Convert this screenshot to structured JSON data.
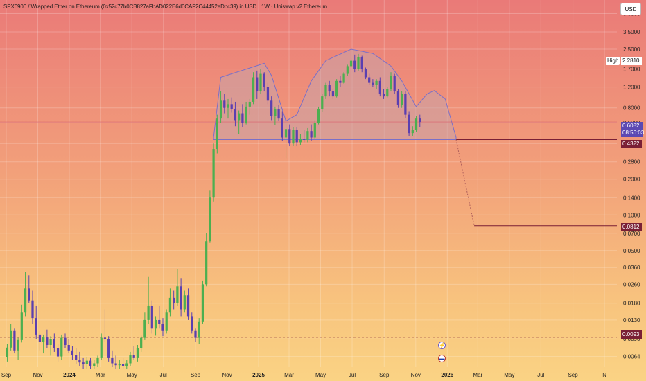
{
  "title": "SPX6900 / Wrapped Ether on Ethereum (0x52c77b0CB827aFbAD022E6d6CAF2C44452eDbc39) in USD · 1W · Uniswap v2 Ethereum",
  "currency_button": "USD",
  "price_labels": {
    "high_label": "High",
    "high_value": "2.2810",
    "current_value": "0.6082",
    "countdown": "08:56:03",
    "neckline_value": "0.4322",
    "target_value": "0.0812",
    "support_value": "0.0093"
  },
  "colors": {
    "bull": "#4caf50",
    "bear": "#5b3fb0",
    "pattern_fill": "#c8a3a9",
    "pattern_stroke": "#7a6fc8",
    "level_line": "#7a1f35",
    "current_tag": "#5b49b3"
  },
  "events": [
    {
      "icon": "lightning-icon",
      "glyph": "⚡"
    },
    {
      "icon": "us-flag-icon",
      "glyph": "▬"
    }
  ],
  "chart_data": {
    "type": "candlestick",
    "scale": "log",
    "y_ticks": [
      "5.0000",
      "3.5000",
      "2.5000",
      "1.7000",
      "1.2000",
      "0.8000",
      "0.6000",
      "0.4000",
      "0.2800",
      "0.2000",
      "0.1400",
      "0.1000",
      "0.0700",
      "0.0500",
      "0.0360",
      "0.0260",
      "0.0180",
      "0.0130",
      "0.0090",
      "0.0064"
    ],
    "ylim": [
      0.0052,
      6.5
    ],
    "x_ticks": [
      {
        "label": "Sep",
        "bold": false,
        "date": "2023-09-01"
      },
      {
        "label": "Nov",
        "bold": false,
        "date": "2023-11-01"
      },
      {
        "label": "2024",
        "bold": true,
        "date": "2024-01-01"
      },
      {
        "label": "Mar",
        "bold": false,
        "date": "2024-03-01"
      },
      {
        "label": "May",
        "bold": false,
        "date": "2024-05-01"
      },
      {
        "label": "Jul",
        "bold": false,
        "date": "2024-07-01"
      },
      {
        "label": "Sep",
        "bold": false,
        "date": "2024-09-01"
      },
      {
        "label": "Nov",
        "bold": false,
        "date": "2024-11-01"
      },
      {
        "label": "2025",
        "bold": true,
        "date": "2025-01-01"
      },
      {
        "label": "Mar",
        "bold": false,
        "date": "2025-03-01"
      },
      {
        "label": "May",
        "bold": false,
        "date": "2025-05-01"
      },
      {
        "label": "Jul",
        "bold": false,
        "date": "2025-07-01"
      },
      {
        "label": "Sep",
        "bold": false,
        "date": "2025-09-01"
      },
      {
        "label": "Nov",
        "bold": false,
        "date": "2025-11-01"
      },
      {
        "label": "2026",
        "bold": true,
        "date": "2026-01-01"
      },
      {
        "label": "Mar",
        "bold": false,
        "date": "2026-03-01"
      },
      {
        "label": "May",
        "bold": false,
        "date": "2026-05-01"
      },
      {
        "label": "Jul",
        "bold": false,
        "date": "2026-07-01"
      },
      {
        "label": "Sep",
        "bold": false,
        "date": "2026-09-01"
      },
      {
        "label": "N",
        "bold": false,
        "date": "2026-11-01"
      }
    ],
    "xlim": [
      "2023-08-20",
      "2026-11-25"
    ],
    "candles": [
      [
        "2023-09-03",
        0.0063,
        0.0082,
        0.0058,
        0.0076
      ],
      [
        "2023-09-10",
        0.0076,
        0.012,
        0.0072,
        0.0105
      ],
      [
        "2023-09-17",
        0.0105,
        0.011,
        0.0068,
        0.0072
      ],
      [
        "2023-09-24",
        0.0072,
        0.0092,
        0.006,
        0.0088
      ],
      [
        "2023-10-01",
        0.0088,
        0.0175,
        0.0084,
        0.015
      ],
      [
        "2023-10-08",
        0.015,
        0.033,
        0.014,
        0.024
      ],
      [
        "2023-10-15",
        0.024,
        0.031,
        0.018,
        0.019
      ],
      [
        "2023-10-22",
        0.019,
        0.023,
        0.012,
        0.0135
      ],
      [
        "2023-10-29",
        0.0135,
        0.017,
        0.009,
        0.0098
      ],
      [
        "2023-11-05",
        0.0098,
        0.0105,
        0.0072,
        0.0085
      ],
      [
        "2023-11-12",
        0.0085,
        0.0098,
        0.0068,
        0.0094
      ],
      [
        "2023-11-19",
        0.0094,
        0.0108,
        0.0075,
        0.008
      ],
      [
        "2023-11-26",
        0.008,
        0.0095,
        0.0065,
        0.009
      ],
      [
        "2023-12-03",
        0.009,
        0.01,
        0.007,
        0.0075
      ],
      [
        "2023-12-10",
        0.0075,
        0.0082,
        0.0058,
        0.0064
      ],
      [
        "2023-12-17",
        0.0064,
        0.0098,
        0.006,
        0.0092
      ],
      [
        "2023-12-24",
        0.0092,
        0.01,
        0.0075,
        0.008
      ],
      [
        "2023-12-31",
        0.008,
        0.009,
        0.0068,
        0.0072
      ],
      [
        "2024-01-07",
        0.0072,
        0.0078,
        0.006,
        0.0066
      ],
      [
        "2024-01-14",
        0.0066,
        0.0075,
        0.0055,
        0.006
      ],
      [
        "2024-01-21",
        0.006,
        0.007,
        0.0053,
        0.0057
      ],
      [
        "2024-01-28",
        0.0057,
        0.0062,
        0.005,
        0.0055
      ],
      [
        "2024-02-04",
        0.0055,
        0.0063,
        0.005,
        0.0059
      ],
      [
        "2024-02-11",
        0.0059,
        0.0062,
        0.005,
        0.0053
      ],
      [
        "2024-02-18",
        0.0053,
        0.006,
        0.005,
        0.0056
      ],
      [
        "2024-02-25",
        0.0056,
        0.0065,
        0.0052,
        0.0062
      ],
      [
        "2024-03-03",
        0.0062,
        0.01,
        0.006,
        0.0092
      ],
      [
        "2024-03-10",
        0.0092,
        0.016,
        0.0085,
        0.009
      ],
      [
        "2024-03-17",
        0.009,
        0.0095,
        0.0058,
        0.0062
      ],
      [
        "2024-03-24",
        0.0062,
        0.0072,
        0.0052,
        0.0056
      ],
      [
        "2024-03-31",
        0.0056,
        0.0065,
        0.005,
        0.0054
      ],
      [
        "2024-04-07",
        0.0054,
        0.006,
        0.005,
        0.0055
      ],
      [
        "2024-04-14",
        0.0055,
        0.0062,
        0.005,
        0.0053
      ],
      [
        "2024-04-21",
        0.0053,
        0.006,
        0.005,
        0.0056
      ],
      [
        "2024-04-28",
        0.0056,
        0.007,
        0.0053,
        0.0066
      ],
      [
        "2024-05-05",
        0.0066,
        0.0078,
        0.006,
        0.0062
      ],
      [
        "2024-05-12",
        0.0062,
        0.008,
        0.0058,
        0.0075
      ],
      [
        "2024-05-19",
        0.0075,
        0.0096,
        0.007,
        0.0092
      ],
      [
        "2024-05-26",
        0.0092,
        0.015,
        0.0088,
        0.013
      ],
      [
        "2024-06-02",
        0.013,
        0.03,
        0.012,
        0.017
      ],
      [
        "2024-06-09",
        0.017,
        0.019,
        0.01,
        0.011
      ],
      [
        "2024-06-16",
        0.011,
        0.014,
        0.0096,
        0.013
      ],
      [
        "2024-06-23",
        0.013,
        0.017,
        0.011,
        0.012
      ],
      [
        "2024-06-30",
        0.012,
        0.0135,
        0.0095,
        0.0105
      ],
      [
        "2024-07-07",
        0.0105,
        0.016,
        0.01,
        0.015
      ],
      [
        "2024-07-14",
        0.015,
        0.024,
        0.014,
        0.02
      ],
      [
        "2024-07-21",
        0.02,
        0.023,
        0.016,
        0.018
      ],
      [
        "2024-07-28",
        0.018,
        0.035,
        0.017,
        0.025
      ],
      [
        "2024-08-04",
        0.025,
        0.029,
        0.014,
        0.016
      ],
      [
        "2024-08-11",
        0.016,
        0.023,
        0.015,
        0.021
      ],
      [
        "2024-08-18",
        0.021,
        0.024,
        0.013,
        0.014
      ],
      [
        "2024-08-25",
        0.014,
        0.015,
        0.01,
        0.0105
      ],
      [
        "2024-09-01",
        0.0105,
        0.011,
        0.0085,
        0.0092
      ],
      [
        "2024-09-08",
        0.0092,
        0.0135,
        0.0082,
        0.0125
      ],
      [
        "2024-09-15",
        0.0125,
        0.028,
        0.012,
        0.026
      ],
      [
        "2024-09-22",
        0.026,
        0.07,
        0.025,
        0.06
      ],
      [
        "2024-09-29",
        0.06,
        0.16,
        0.058,
        0.14
      ],
      [
        "2024-10-06",
        0.14,
        0.4,
        0.13,
        0.36
      ],
      [
        "2024-10-13",
        0.36,
        0.7,
        0.33,
        0.65
      ],
      [
        "2024-10-20",
        0.65,
        1.1,
        0.6,
        0.92
      ],
      [
        "2024-10-27",
        0.92,
        1.05,
        0.72,
        0.8
      ],
      [
        "2024-11-03",
        0.8,
        0.95,
        0.65,
        0.86
      ],
      [
        "2024-11-10",
        0.86,
        0.98,
        0.73,
        0.78
      ],
      [
        "2024-11-17",
        0.78,
        0.9,
        0.56,
        0.63
      ],
      [
        "2024-11-24",
        0.63,
        0.76,
        0.48,
        0.72
      ],
      [
        "2024-12-01",
        0.72,
        0.86,
        0.55,
        0.6
      ],
      [
        "2024-12-08",
        0.6,
        0.9,
        0.58,
        0.82
      ],
      [
        "2024-12-15",
        0.82,
        0.95,
        0.7,
        0.9
      ],
      [
        "2024-12-22",
        0.9,
        1.6,
        0.86,
        1.45
      ],
      [
        "2024-12-29",
        1.45,
        1.65,
        0.95,
        1.1
      ],
      [
        "2025-01-05",
        1.1,
        1.7,
        1.05,
        1.55
      ],
      [
        "2025-01-12",
        1.55,
        1.6,
        1.1,
        1.2
      ],
      [
        "2025-01-19",
        1.2,
        1.3,
        0.86,
        0.92
      ],
      [
        "2025-01-26",
        0.92,
        1.0,
        0.63,
        0.68
      ],
      [
        "2025-02-02",
        0.68,
        0.82,
        0.57,
        0.78
      ],
      [
        "2025-02-09",
        0.78,
        0.85,
        0.62,
        0.65
      ],
      [
        "2025-02-16",
        0.65,
        0.75,
        0.42,
        0.45
      ],
      [
        "2025-02-23",
        0.45,
        0.58,
        0.3,
        0.53
      ],
      [
        "2025-03-02",
        0.53,
        0.58,
        0.38,
        0.4
      ],
      [
        "2025-03-09",
        0.4,
        0.55,
        0.38,
        0.52
      ],
      [
        "2025-03-16",
        0.52,
        0.55,
        0.38,
        0.41
      ],
      [
        "2025-03-23",
        0.41,
        0.48,
        0.39,
        0.44
      ],
      [
        "2025-03-30",
        0.44,
        0.52,
        0.41,
        0.43
      ],
      [
        "2025-04-06",
        0.43,
        0.54,
        0.41,
        0.51
      ],
      [
        "2025-04-13",
        0.51,
        0.58,
        0.42,
        0.45
      ],
      [
        "2025-04-20",
        0.45,
        0.63,
        0.44,
        0.6
      ],
      [
        "2025-04-27",
        0.6,
        0.82,
        0.58,
        0.78
      ],
      [
        "2025-05-04",
        0.78,
        1.05,
        0.74,
        1.0
      ],
      [
        "2025-05-11",
        1.0,
        1.3,
        0.95,
        1.25
      ],
      [
        "2025-05-18",
        1.25,
        1.35,
        1.0,
        1.1
      ],
      [
        "2025-05-25",
        1.1,
        1.15,
        0.95,
        1.0
      ],
      [
        "2025-06-01",
        1.0,
        1.4,
        0.98,
        1.35
      ],
      [
        "2025-06-08",
        1.35,
        1.5,
        1.2,
        1.3
      ],
      [
        "2025-06-15",
        1.3,
        1.6,
        1.28,
        1.55
      ],
      [
        "2025-06-22",
        1.55,
        1.85,
        1.5,
        1.8
      ],
      [
        "2025-06-29",
        1.8,
        2.1,
        1.75,
        2.0
      ],
      [
        "2025-07-06",
        2.0,
        2.25,
        1.6,
        1.7
      ],
      [
        "2025-07-13",
        1.7,
        2.281,
        1.65,
        2.15
      ],
      [
        "2025-07-20",
        2.15,
        2.2,
        1.6,
        1.7
      ],
      [
        "2025-07-27",
        1.7,
        1.75,
        1.4,
        1.45
      ],
      [
        "2025-08-03",
        1.45,
        1.55,
        1.25,
        1.3
      ],
      [
        "2025-08-10",
        1.3,
        1.4,
        1.2,
        1.25
      ],
      [
        "2025-08-17",
        1.25,
        1.4,
        1.15,
        1.35
      ],
      [
        "2025-08-24",
        1.35,
        1.45,
        1.0,
        1.05
      ],
      [
        "2025-08-31",
        1.05,
        1.15,
        0.95,
        1.0
      ],
      [
        "2025-09-07",
        1.0,
        1.2,
        0.98,
        1.15
      ],
      [
        "2025-09-14",
        1.15,
        1.6,
        1.1,
        1.5
      ],
      [
        "2025-09-21",
        1.5,
        1.55,
        1.05,
        1.1
      ],
      [
        "2025-09-28",
        1.1,
        1.15,
        0.8,
        0.85
      ],
      [
        "2025-10-05",
        0.85,
        1.1,
        0.8,
        1.05
      ],
      [
        "2025-10-12",
        1.05,
        1.1,
        0.66,
        0.7
      ],
      [
        "2025-10-19",
        0.7,
        0.75,
        0.46,
        0.49
      ],
      [
        "2025-10-26",
        0.49,
        0.56,
        0.46,
        0.52
      ],
      [
        "2025-11-02",
        0.52,
        0.68,
        0.5,
        0.65
      ],
      [
        "2025-11-09",
        0.65,
        0.7,
        0.55,
        0.6082
      ]
    ],
    "pattern": {
      "name": "head-and-shoulders",
      "outline": [
        [
          "2024-10-06",
          0.45
        ],
        [
          "2024-10-20",
          1.45
        ],
        [
          "2025-01-12",
          1.9
        ],
        [
          "2025-01-26",
          1.5
        ],
        [
          "2025-02-23",
          0.62
        ],
        [
          "2025-03-16",
          0.7
        ],
        [
          "2025-04-13",
          1.35
        ],
        [
          "2025-05-11",
          2.0
        ],
        [
          "2025-06-29",
          2.5
        ],
        [
          "2025-08-10",
          2.3
        ],
        [
          "2025-09-14",
          1.8
        ],
        [
          "2025-10-05",
          1.35
        ],
        [
          "2025-11-02",
          0.82
        ],
        [
          "2025-11-23",
          1.05
        ],
        [
          "2025-12-07",
          1.12
        ],
        [
          "2025-12-28",
          0.95
        ],
        [
          "2026-01-18",
          0.45
        ]
      ],
      "neckline_value": 0.4322
    },
    "projection": {
      "from": [
        "2026-01-18",
        0.4322
      ],
      "to": [
        "2026-02-22",
        0.0812
      ]
    },
    "levels": [
      {
        "value": 0.4322,
        "from": "2026-01-18",
        "style": "solid"
      },
      {
        "value": 0.0812,
        "from": "2026-02-22",
        "style": "solid"
      },
      {
        "value": 0.0093,
        "from": "2023-08-20",
        "style": "dashed"
      },
      {
        "value": 0.6082,
        "from": "2023-08-20",
        "style": "faint"
      }
    ]
  }
}
